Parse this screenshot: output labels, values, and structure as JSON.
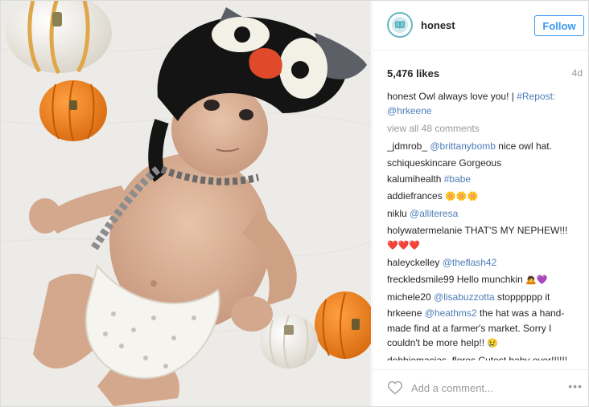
{
  "post": {
    "username": "honest",
    "follow_label": "Follow",
    "likes": "5,476 likes",
    "age": "4d",
    "caption_user": "honest",
    "caption_text": "Owl always love you! | ",
    "caption_tag": "#Repost:",
    "caption_mention": "@hrkeene",
    "view_all": "view all 48 comments",
    "add_comment_placeholder": "Add a comment...",
    "more": "•••"
  },
  "comments": [
    {
      "user": "_jdmrob_",
      "mention": "@brittanybomb",
      "text": " nice owl hat.",
      "emoji": ""
    },
    {
      "user": "schiqueskincare",
      "mention": "",
      "text": " Gorgeous",
      "emoji": ""
    },
    {
      "user": "kalumihealth",
      "mention": "#babe",
      "text": "",
      "emoji": ""
    },
    {
      "user": "addiefrances",
      "mention": "",
      "text": " ",
      "emoji": "🌼🌼🌼"
    },
    {
      "user": "niklu",
      "mention": "@alliteresa",
      "text": "",
      "emoji": ""
    },
    {
      "user": "holywatermelanie",
      "mention": "",
      "text": " THAT'S MY NEPHEW!!! ",
      "emoji": "❤️❤️❤️"
    },
    {
      "user": "haleyckelley",
      "mention": "@theflash42",
      "text": "",
      "emoji": ""
    },
    {
      "user": "freckledsmile99",
      "mention": "",
      "text": " Hello munchkin ",
      "emoji": "🙇💜"
    },
    {
      "user": "michele20",
      "mention": "@lisabuzzotta",
      "text": " stopppppp it",
      "emoji": ""
    },
    {
      "user": "hrkeene",
      "mention": "@heathms2",
      "text": " the hat was a hand-made find at a farmer's market. Sorry I couldn't be more help!! ",
      "emoji": "😢"
    },
    {
      "user": "debbiemacias_flores",
      "mention": "",
      "text": " Cutest baby ever!!!!!! ",
      "emoji": ""
    }
  ],
  "last_partial_mention": "@hrkeene",
  "colors": {
    "link": "#3897f0",
    "mention": "#4c7cb8",
    "muted": "#999999",
    "text": "#262626"
  }
}
